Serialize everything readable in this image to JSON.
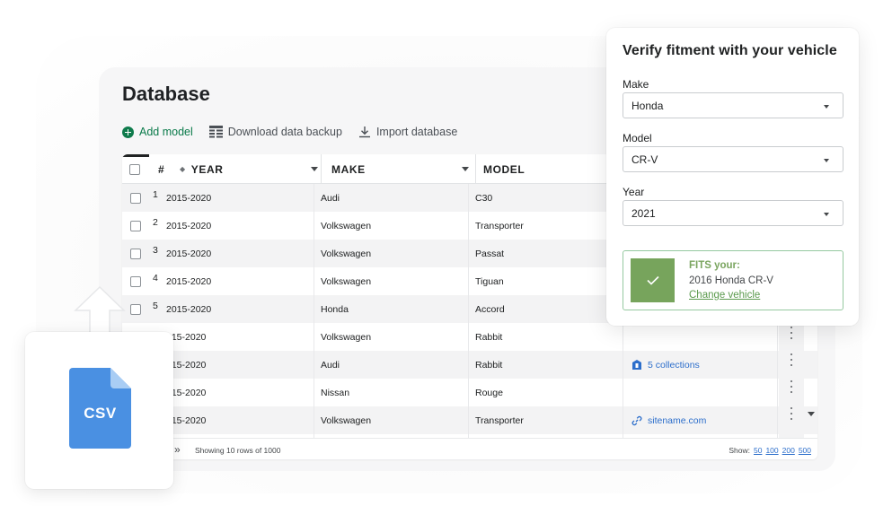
{
  "database": {
    "title": "Database",
    "toolbar": {
      "add_model": "Add model",
      "download_backup": "Download data backup",
      "import_database": "Import database"
    },
    "columns": {
      "num": "#",
      "year": "YEAR",
      "make": "MAKE",
      "model": "MODEL"
    },
    "rows": [
      {
        "num": "1",
        "year": "2015-2020",
        "make": "Audi",
        "model": "C30"
      },
      {
        "num": "2",
        "year": "2015-2020",
        "make": "Volkswagen",
        "model": "Transporter"
      },
      {
        "num": "3",
        "year": "2015-2020",
        "make": "Volkswagen",
        "model": "Passat"
      },
      {
        "num": "4",
        "year": "2015-2020",
        "make": "Volkswagen",
        "model": "Tiguan"
      },
      {
        "num": "5",
        "year": "2015-2020",
        "make": "Honda",
        "model": "Accord"
      },
      {
        "num": "",
        "year": "015-2020",
        "make": "Volkswagen",
        "model": "Rabbit"
      },
      {
        "num": "",
        "year": "015-2020",
        "make": "Audi",
        "model": "Rabbit",
        "extra": "5 collections"
      },
      {
        "num": "",
        "year": "015-2020",
        "make": "Nissan",
        "model": "Rouge"
      },
      {
        "num": "",
        "year": "015-2020",
        "make": "Volkswagen",
        "model": "Transporter",
        "extra": "sitename.com"
      }
    ],
    "footer": {
      "showing": "Showing 10 rows of 1000",
      "show_label": "Show:",
      "show_options": [
        "50",
        "100",
        "200",
        "500"
      ]
    }
  },
  "csv_card": {
    "label": "CSV"
  },
  "fitment": {
    "title": "Verify fitment with your vehicle",
    "make": {
      "label": "Make",
      "value": "Honda"
    },
    "model": {
      "label": "Model",
      "value": "CR-V"
    },
    "year": {
      "label": "Year",
      "value": "2021"
    },
    "result": {
      "heading": "FITS your:",
      "vehicle": "2016 Honda CR-V",
      "change_link": "Change vehicle"
    }
  },
  "colors": {
    "accent_green": "#0f7b4c",
    "fits_green": "#77a45c",
    "link_blue": "#2c6ecb",
    "csv_blue": "#4a90e2"
  }
}
